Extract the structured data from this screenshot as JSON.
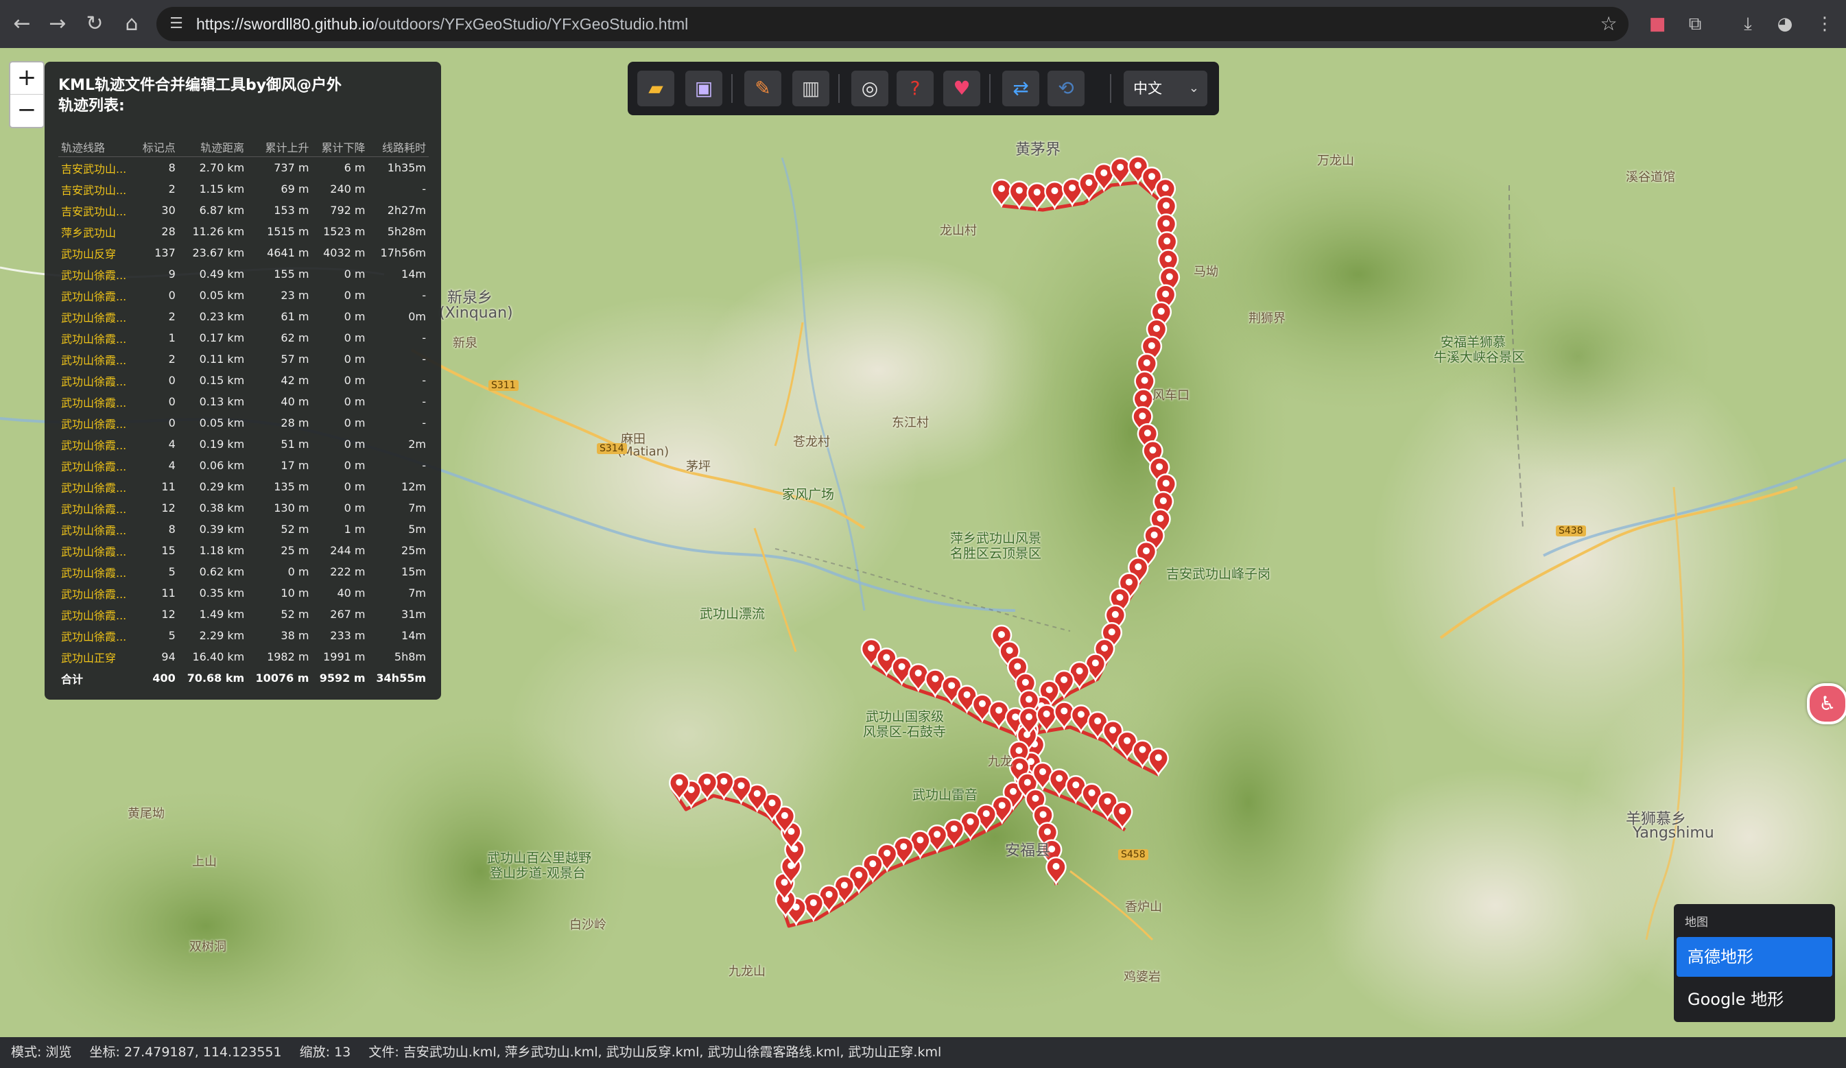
{
  "browser": {
    "url_host": "https://swordll80.github.io",
    "url_path": "/outdoors/YFxGeoStudio/YFxGeoStudio.html"
  },
  "panel": {
    "title": "KML轨迹文件合并编辑工具by御风@户外",
    "subtitle": "轨迹列表:",
    "columns": [
      "轨迹线路",
      "标记点",
      "轨迹距离",
      "累计上升",
      "累计下降",
      "线路耗时"
    ],
    "rows": [
      [
        "吉安武功山...",
        "8",
        "2.70 km",
        "737 m",
        "6 m",
        "1h35m"
      ],
      [
        "吉安武功山...",
        "2",
        "1.15 km",
        "69 m",
        "240 m",
        "-"
      ],
      [
        "吉安武功山...",
        "30",
        "6.87 km",
        "153 m",
        "792 m",
        "2h27m"
      ],
      [
        "萍乡武功山",
        "28",
        "11.26 km",
        "1515 m",
        "1523 m",
        "5h28m"
      ],
      [
        "武功山反穿",
        "137",
        "23.67 km",
        "4641 m",
        "4032 m",
        "17h56m"
      ],
      [
        "武功山徐霞...",
        "9",
        "0.49 km",
        "155 m",
        "0 m",
        "14m"
      ],
      [
        "武功山徐霞...",
        "0",
        "0.05 km",
        "23 m",
        "0 m",
        "-"
      ],
      [
        "武功山徐霞...",
        "2",
        "0.23 km",
        "61 m",
        "0 m",
        "0m"
      ],
      [
        "武功山徐霞...",
        "1",
        "0.17 km",
        "62 m",
        "0 m",
        "-"
      ],
      [
        "武功山徐霞...",
        "2",
        "0.11 km",
        "57 m",
        "0 m",
        "-"
      ],
      [
        "武功山徐霞...",
        "0",
        "0.15 km",
        "42 m",
        "0 m",
        "-"
      ],
      [
        "武功山徐霞...",
        "0",
        "0.13 km",
        "40 m",
        "0 m",
        "-"
      ],
      [
        "武功山徐霞...",
        "0",
        "0.05 km",
        "28 m",
        "0 m",
        "-"
      ],
      [
        "武功山徐霞...",
        "4",
        "0.19 km",
        "51 m",
        "0 m",
        "2m"
      ],
      [
        "武功山徐霞...",
        "4",
        "0.06 km",
        "17 m",
        "0 m",
        "-"
      ],
      [
        "武功山徐霞...",
        "11",
        "0.29 km",
        "135 m",
        "0 m",
        "12m"
      ],
      [
        "武功山徐霞...",
        "12",
        "0.38 km",
        "130 m",
        "0 m",
        "7m"
      ],
      [
        "武功山徐霞...",
        "8",
        "0.39 km",
        "52 m",
        "1 m",
        "5m"
      ],
      [
        "武功山徐霞...",
        "15",
        "1.18 km",
        "25 m",
        "244 m",
        "25m"
      ],
      [
        "武功山徐霞...",
        "5",
        "0.62 km",
        "0 m",
        "222 m",
        "15m"
      ],
      [
        "武功山徐霞...",
        "11",
        "0.35 km",
        "10 m",
        "40 m",
        "7m"
      ],
      [
        "武功山徐霞...",
        "12",
        "1.49 km",
        "52 m",
        "267 m",
        "31m"
      ],
      [
        "武功山徐霞...",
        "5",
        "2.29 km",
        "38 m",
        "233 m",
        "14m"
      ],
      [
        "武功山正穿",
        "94",
        "16.40 km",
        "1982 m",
        "1991 m",
        "5h8m"
      ]
    ],
    "total": [
      "合计",
      "400",
      "70.68 km",
      "10076 m",
      "9592 m",
      "34h55m"
    ]
  },
  "toolbar": {
    "icons": [
      "open-folder-icon",
      "save-icon",
      "edit-pencil-icon",
      "delete-trash-icon",
      "target-icon",
      "help-icon",
      "heart-icon",
      "swap-icon",
      "clear-icon"
    ],
    "language": "中文"
  },
  "zoom": {
    "plus": "+",
    "minus": "−"
  },
  "layers": {
    "header": "地图",
    "options": [
      "高德地形",
      "Google 地形"
    ],
    "selected": "高德地形"
  },
  "map_labels": [
    "黄茅界",
    "万龙山",
    "溪谷道馆",
    "新泉乡",
    "(Xinquan)",
    "马坳",
    "荆狮界",
    "风车口",
    "安福羊狮慕",
    "牛溪大峡谷景区",
    "萍乡武功山风景",
    "名胜区云顶景区",
    "吉安武功山峰子岗",
    "家风广场",
    "武功山漂流",
    "武功山国家级",
    "风景区-石鼓寺",
    "麻田",
    "(Matian)",
    "武功山雷音",
    "安福县",
    "武功山百公里越野",
    "登山步道-观景台",
    "黄尾坳",
    "双树洞",
    "九龙山",
    "香炉山",
    "鸡婆岩",
    "羊狮慕乡",
    "Yangshimu",
    "S314",
    "S311",
    "S438",
    "S458",
    "九龙",
    "新泉",
    "龙山村",
    "上山",
    "白沙岭",
    "东江村",
    "茅坪",
    "苍龙村"
  ],
  "status": {
    "mode": "模式: 浏览",
    "coords": "坐标: 27.479187, 114.123551",
    "zoom": "缩放: 13",
    "files": "文件: 吉安武功山.kml, 萍乡武功山.kml, 武功山反穿.kml, 武功山徐霞客路线.kml, 武功山正穿.kml"
  },
  "colors": {
    "marker": "#d9302c",
    "track_name": "#f0c419",
    "active_layer": "#1a73e8"
  }
}
